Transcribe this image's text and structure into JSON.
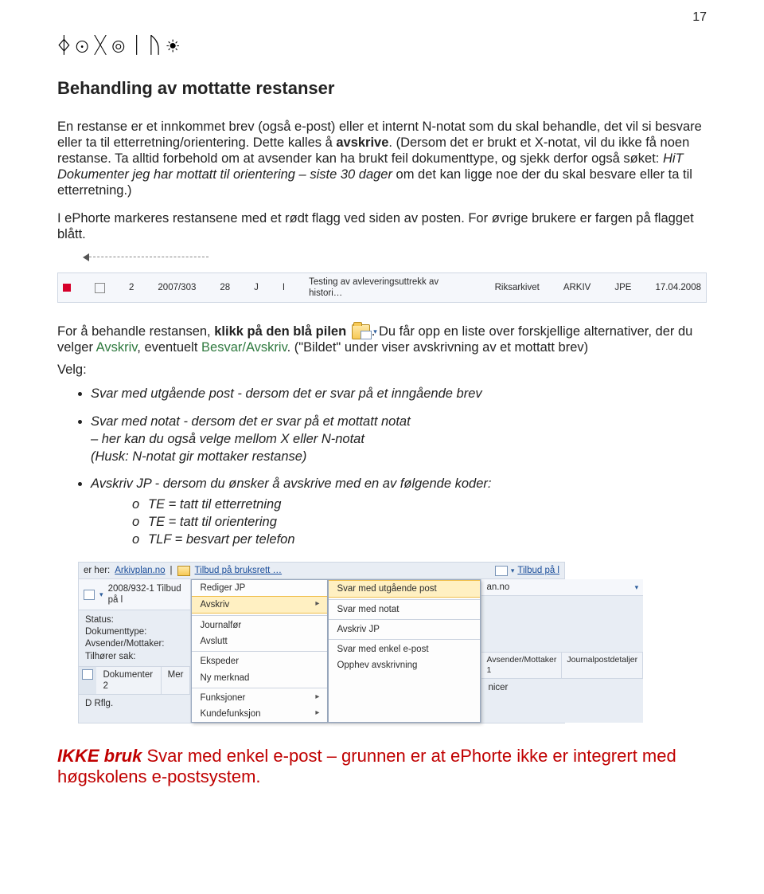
{
  "page_number": "17",
  "header_symbols": "ᛄ☉ᚷ◎ᛁᚢ☀",
  "title": "Behandling av mottatte restanser",
  "p1_a": "En restanse er et innkommet brev (også e-post) eller et internt N-notat som du skal behandle, det vil si besvare eller ta til etterretning/orientering. Dette kalles å ",
  "p1_b": "avskrive",
  "p1_c": ". (Dersom det er brukt et X-notat, vil du ikke få noen restanse. Ta alltid forbehold om at avsender kan ha brukt feil dokumenttype, og sjekk derfor også søket: ",
  "p1_d": "HiT Dokumenter jeg har mottatt til orientering – siste 30 dager",
  "p1_e": " om det kan ligge noe der du skal besvare eller ta til etterretning.)",
  "p2": "I ePhorte markeres restansene med et rødt flagg ved siden av posten. For øvrige brukere er fargen på flagget blått.",
  "shot1": {
    "col1": "2",
    "case": "2007/303",
    "col3": "28",
    "col4": "J",
    "col5": "I",
    "title": "Testing av avleveringsuttrekk av histori…",
    "org": "Riksarkivet",
    "dept": "ARKIV",
    "user": "JPE",
    "date": "17.04.2008"
  },
  "p3_a": "For å behandle restansen, ",
  "p3_b": "klikk på den blå pilen",
  "p3_c": ". Du får opp en liste over forskjellige alternativer, der du velger ",
  "p3_d": "Avskriv",
  "p3_e": ", eventuelt ",
  "p3_f": "Besvar/Avskriv",
  "p3_g": ". (\"Bildet\" under viser avskrivning av et mottatt brev)",
  "p3_h": "Velg:",
  "bullets": [
    {
      "text": "Svar med utgående post - dersom det er svar på et inngående brev"
    },
    {
      "text": "Svar med notat - dersom det er svar på et mottatt notat",
      "sub1": "– her kan du også velge mellom X eller N-notat",
      "sub2": "(Husk: N-notat gir mottaker restanse)"
    },
    {
      "text": "Avskriv JP - dersom du ønsker å avskrive med en av følgende koder:"
    }
  ],
  "circles": [
    "TE = tatt til etterretning",
    "TE = tatt til orientering",
    "TLF = besvart per telefon"
  ],
  "shot2": {
    "breadcrumb_a": "er her:",
    "breadcrumb_b": "Arkivplan.no",
    "breadcrumb_sep": "|",
    "breadcrumb_c": "Tilbud på bruksrett …",
    "dropdown_right": "Tilbud på l",
    "row_case": "2008/932-1 Tilbud på l",
    "details": {
      "Status": "Status:",
      "Dokumenttype": "Dokumenttype:",
      "Avsender": "Avsender/Mottaker:",
      "Tilhorer": "Tilhører sak:"
    },
    "tabs_left": [
      "Dokumenter 2",
      "Mer"
    ],
    "bottom_left": "D  Rflg.",
    "menu1": [
      "Rediger JP",
      "Avskriv",
      "Journalfør",
      "Avslutt",
      "Ekspeder",
      "Ny merknad",
      "Funksjoner",
      "Kundefunksjon"
    ],
    "menu2": [
      "Svar med utgående post",
      "Svar med notat",
      "Avskriv JP",
      "Svar med enkel e-post",
      "Opphev avskrivning"
    ],
    "right_drop": "an.no",
    "tabs_right": [
      "Avsender/Mottaker 1",
      "Journalpostdetaljer"
    ],
    "bottom_right": "nicer"
  },
  "warn_a": "IKKE bruk",
  "warn_b": " Svar med enkel e-post – grunnen er at ePhorte ikke er integrert med høgskolens e-postsystem."
}
